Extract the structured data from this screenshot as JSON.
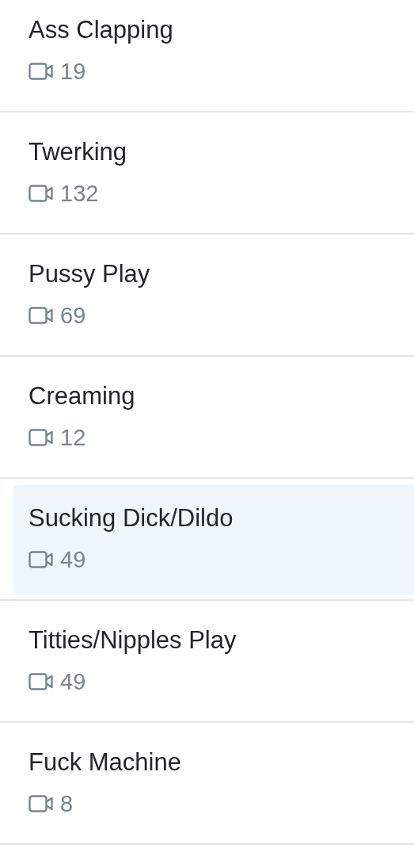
{
  "categories": [
    {
      "title": "Ass Clapping",
      "count": "19",
      "selected": false
    },
    {
      "title": "Twerking",
      "count": "132",
      "selected": false
    },
    {
      "title": "Pussy Play",
      "count": "69",
      "selected": false
    },
    {
      "title": "Creaming",
      "count": "12",
      "selected": false
    },
    {
      "title": "Sucking Dick/Dildo",
      "count": "49",
      "selected": true
    },
    {
      "title": "Titties/Nipples Play",
      "count": "49",
      "selected": false
    },
    {
      "title": "Fuck Machine",
      "count": "8",
      "selected": false
    }
  ]
}
